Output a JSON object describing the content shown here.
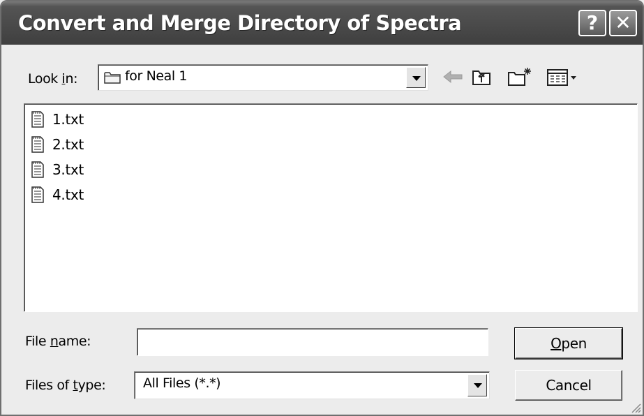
{
  "dialog": {
    "title": "Convert and Merge Directory of Spectra",
    "help_glyph": "?",
    "close_glyph": "✕"
  },
  "look_in": {
    "label_pre": "Look ",
    "label_accel": "i",
    "label_post": "n:",
    "value": "for Neal 1",
    "icon": "folder-icon"
  },
  "toolbar": {
    "icons": [
      "back-arrow-icon",
      "up-folder-icon",
      "new-folder-icon",
      "view-menu-icon"
    ]
  },
  "files": [
    {
      "name": "1.txt",
      "icon": "text-file-icon"
    },
    {
      "name": "2.txt",
      "icon": "text-file-icon"
    },
    {
      "name": "3.txt",
      "icon": "text-file-icon"
    },
    {
      "name": "4.txt",
      "icon": "text-file-icon"
    }
  ],
  "file_name": {
    "label_pre": "File ",
    "label_accel": "n",
    "label_post": "ame:",
    "value": ""
  },
  "file_type": {
    "label_pre": "Files of ",
    "label_accel": "t",
    "label_post": "ype:",
    "value": "All Files (*.*)"
  },
  "buttons": {
    "open_accel": "O",
    "open_rest": "pen",
    "cancel": "Cancel"
  },
  "colors": {
    "titlebar": "#4a4a4a",
    "dialog_bg": "#ececec"
  }
}
